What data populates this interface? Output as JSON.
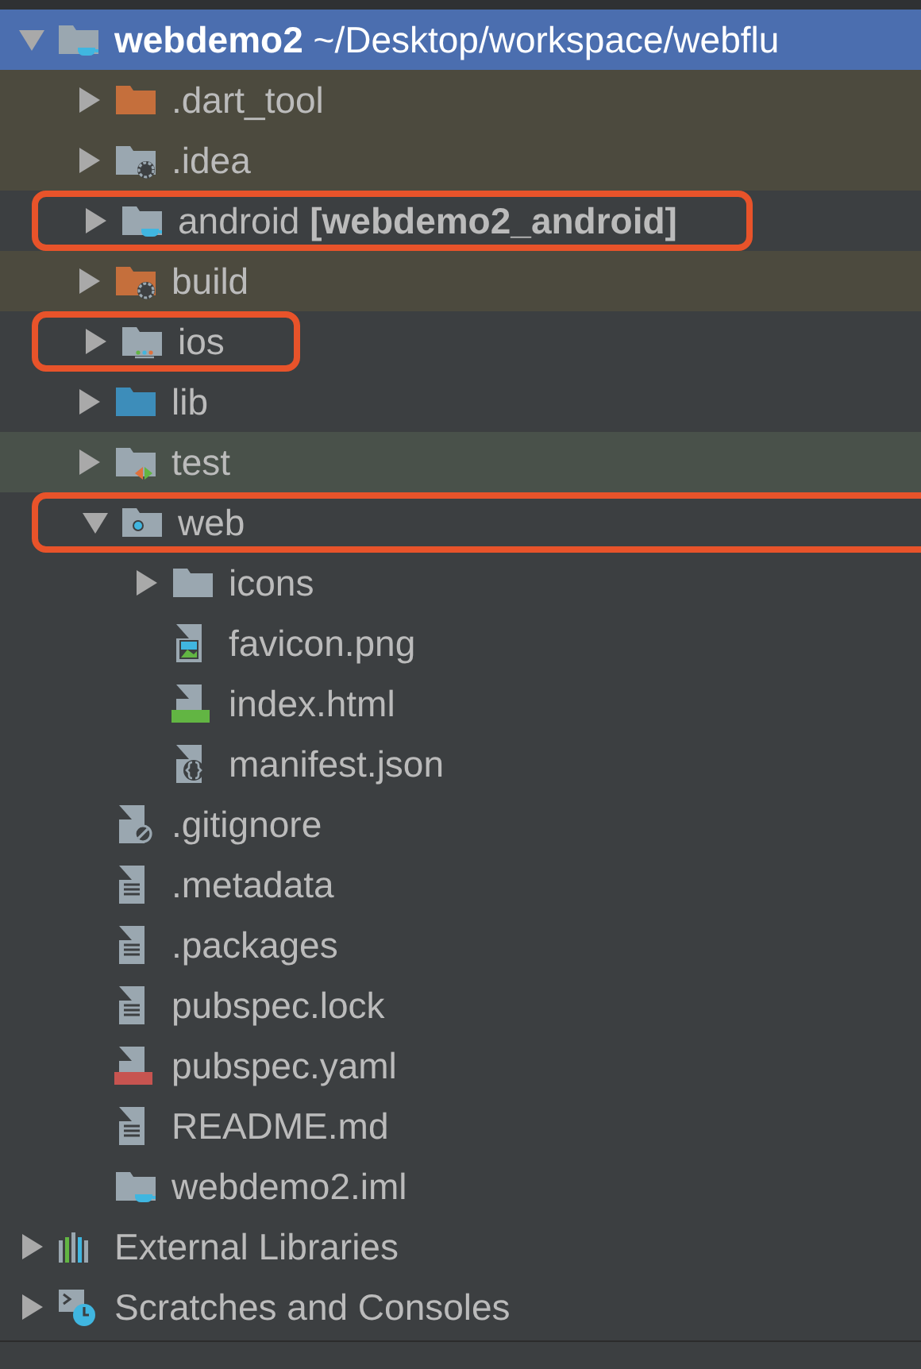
{
  "tree": [
    {
      "label": "**webdemo2**  ~/Desktop/workspace/webflu",
      "kind": "project",
      "expanded": true,
      "selected": true,
      "children": [
        {
          "label": ".dart_tool",
          "kind": "excluded",
          "expanded": false,
          "selected": false,
          "excluded": true,
          "test_source": false
        },
        {
          "label": ".idea",
          "kind": "config",
          "expanded": false,
          "selected": false,
          "excluded": true,
          "test_source": false
        },
        {
          "label": "android **[webdemo2_android]**",
          "kind": "module",
          "expanded": false,
          "selected": false,
          "excluded": false,
          "test_source": false,
          "annotated": true
        },
        {
          "label": "build",
          "kind": "excludedconfig",
          "expanded": false,
          "selected": false,
          "excluded": true,
          "test_source": false
        },
        {
          "label": "ios",
          "kind": "ios",
          "expanded": false,
          "selected": false,
          "excluded": false,
          "test_source": false,
          "annotated": true
        },
        {
          "label": "lib",
          "kind": "source",
          "expanded": false,
          "selected": false,
          "excluded": false,
          "test_source": false
        },
        {
          "label": "test",
          "kind": "test",
          "expanded": false,
          "selected": false,
          "excluded": false,
          "test_source": true
        },
        {
          "label": "web",
          "kind": "web",
          "expanded": true,
          "selected": false,
          "excluded": false,
          "test_source": false,
          "annotated": true,
          "children": [
            {
              "label": "icons",
              "kind": "folder",
              "expanded": false,
              "selected": false
            },
            {
              "label": "favicon.png",
              "kind": "image",
              "selected": false
            },
            {
              "label": "index.html",
              "kind": "html",
              "selected": false
            },
            {
              "label": "manifest.json",
              "kind": "json",
              "selected": false
            }
          ]
        },
        {
          "label": ".gitignore",
          "kind": "ignore",
          "selected": false,
          "excluded": false,
          "test_source": false
        },
        {
          "label": ".metadata",
          "kind": "text",
          "selected": false,
          "excluded": false,
          "test_source": false
        },
        {
          "label": ".packages",
          "kind": "text",
          "selected": false,
          "excluded": false,
          "test_source": false
        },
        {
          "label": "pubspec.lock",
          "kind": "text",
          "selected": false,
          "excluded": false,
          "test_source": false
        },
        {
          "label": "pubspec.yaml",
          "kind": "yaml",
          "selected": false,
          "excluded": false,
          "test_source": false
        },
        {
          "label": "README.md",
          "kind": "text",
          "selected": false,
          "excluded": false,
          "test_source": false
        },
        {
          "label": "webdemo2.iml",
          "kind": "iml",
          "selected": false,
          "excluded": false,
          "test_source": false
        }
      ]
    },
    {
      "label": "External Libraries",
      "kind": "libraries",
      "expanded": false,
      "selected": false
    },
    {
      "label": "Scratches and Consoles",
      "kind": "scratches",
      "expanded": false,
      "selected": false
    }
  ]
}
